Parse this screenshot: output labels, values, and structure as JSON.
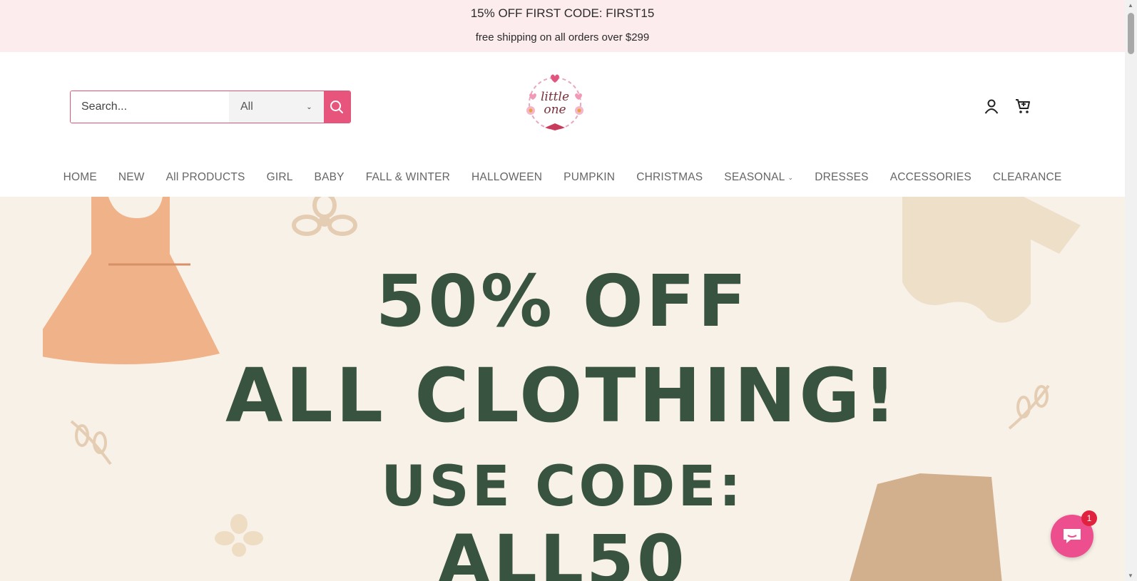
{
  "announcement": {
    "line1": "15% OFF FIRST CODE: FIRST15",
    "line2": "free shipping on all orders over $299"
  },
  "search": {
    "placeholder": "Search...",
    "category": "All",
    "button_icon": "search-icon"
  },
  "logo": {
    "alt": "little one"
  },
  "header_icons": [
    "account-icon",
    "cart-icon"
  ],
  "nav": {
    "items": [
      {
        "label": "HOME"
      },
      {
        "label": "NEW"
      },
      {
        "label": "All PRODUCTS"
      },
      {
        "label": "GIRL"
      },
      {
        "label": "BABY"
      },
      {
        "label": "FALL & WINTER"
      },
      {
        "label": "HALLOWEEN"
      },
      {
        "label": "PUMPKIN"
      },
      {
        "label": "CHRISTMAS"
      },
      {
        "label": "SEASONAL"
      },
      {
        "label": "DRESSES"
      },
      {
        "label": "ACCESSORIES"
      },
      {
        "label": "CLEARANCE"
      }
    ]
  },
  "hero": {
    "line1": "50% OFF",
    "line2": "ALL CLOTHING!",
    "line3": "USE CODE:",
    "line4": "ALL50"
  },
  "chat": {
    "badge": "1"
  },
  "colors": {
    "accent": "#e8557c",
    "announcement_bg": "#fdeced",
    "hero_bg": "#f8f1e7",
    "hero_text": "#38533f"
  }
}
